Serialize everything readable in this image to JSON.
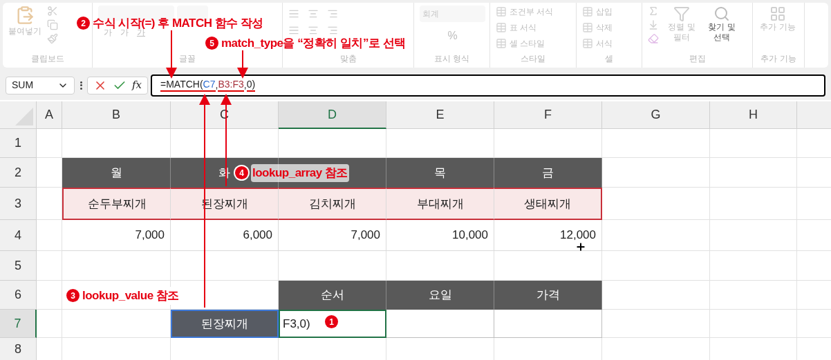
{
  "ribbon": {
    "groups": [
      {
        "kind": "clipboard",
        "label": "클립보드",
        "buttons": [
          {
            "label": "붙여넣기",
            "disabled": true
          }
        ]
      },
      {
        "kind": "font",
        "label": "글꼴",
        "buttons": [
          {
            "label": "가",
            "disabled": true
          },
          {
            "label": "가",
            "disabled": true
          },
          {
            "label": "가",
            "disabled": true
          }
        ]
      },
      {
        "kind": "alignment",
        "label": "맞춤"
      },
      {
        "kind": "number",
        "label": "표시 형식",
        "field": "회계",
        "buttons": [
          {
            "label": "%",
            "disabled": true
          }
        ]
      },
      {
        "kind": "styles",
        "label": "스타일",
        "buttons": [
          {
            "label": "조건부 서식",
            "disabled": true
          },
          {
            "label": "표 서식",
            "disabled": true
          },
          {
            "label": "셀 스타일",
            "disabled": true
          }
        ]
      },
      {
        "kind": "cells",
        "label": "셀",
        "buttons": [
          {
            "label": "삽입",
            "disabled": true
          },
          {
            "label": "삭제",
            "disabled": true
          },
          {
            "label": "서식",
            "disabled": true
          }
        ]
      },
      {
        "kind": "editing",
        "label": "편집",
        "buttons": [
          {
            "label": "정렬 및 필터",
            "disabled": true
          },
          {
            "label": "찾기 및 선택",
            "disabled": false
          }
        ]
      },
      {
        "kind": "addins",
        "label": "추가 기능",
        "buttons": [
          {
            "label": "추가 기능",
            "disabled": true
          }
        ]
      }
    ]
  },
  "name_box": {
    "value": "SUM"
  },
  "formula_bar": {
    "function_label": "fx",
    "tokens": [
      {
        "text": "=MATCH(",
        "underlined": true
      },
      {
        "text": "C7",
        "color": "#2f6fd0",
        "underlined": true
      },
      {
        "text": ",",
        "underlined": false
      },
      {
        "text": "B3:F3",
        "color": "#a8323c",
        "underlined": true
      },
      {
        "text": ",",
        "underlined": false
      },
      {
        "text": "0)",
        "underlined": true
      }
    ]
  },
  "sheet": {
    "columns": [
      {
        "label": "A",
        "selected": false
      },
      {
        "label": "B",
        "selected": false
      },
      {
        "label": "C",
        "selected": false
      },
      {
        "label": "D",
        "selected": true
      },
      {
        "label": "E",
        "selected": false
      },
      {
        "label": "F",
        "selected": false
      },
      {
        "label": "G",
        "selected": false
      },
      {
        "label": "H",
        "selected": false
      }
    ],
    "rows": [
      {
        "label": "1",
        "selected": false,
        "cells": [
          null,
          null,
          null,
          null,
          null,
          null,
          null,
          null
        ]
      },
      {
        "label": "2",
        "selected": false,
        "cells": [
          null,
          {
            "kind": "header",
            "text": "월"
          },
          {
            "kind": "header",
            "text": "화"
          },
          {
            "kind": "header"
          },
          {
            "kind": "header",
            "text": "목"
          },
          {
            "kind": "header",
            "text": "금"
          },
          null,
          null
        ]
      },
      {
        "label": "3",
        "selected": false,
        "cells": [
          null,
          {
            "kind": "range",
            "text": "순두부찌개"
          },
          {
            "kind": "range",
            "text": "된장찌개"
          },
          {
            "kind": "range",
            "text": "김치찌개"
          },
          {
            "kind": "range",
            "text": "부대찌개"
          },
          {
            "kind": "range",
            "text": "생태찌개"
          },
          null,
          null
        ]
      },
      {
        "label": "4",
        "selected": false,
        "cells": [
          null,
          {
            "kind": "number",
            "text": "7,000"
          },
          {
            "kind": "number",
            "text": "6,000"
          },
          {
            "kind": "number",
            "text": "7,000"
          },
          {
            "kind": "number",
            "text": "10,000"
          },
          {
            "kind": "number",
            "text": "12,000"
          },
          null,
          null
        ]
      },
      {
        "label": "5",
        "selected": false,
        "cells": [
          null,
          null,
          null,
          null,
          null,
          null,
          null,
          null
        ]
      },
      {
        "label": "6",
        "selected": false,
        "cells": [
          null,
          null,
          null,
          {
            "kind": "header",
            "text": "순서"
          },
          {
            "kind": "header",
            "text": "요일"
          },
          {
            "kind": "header",
            "text": "가격"
          },
          null,
          null
        ]
      },
      {
        "label": "7",
        "selected": true,
        "cells": [
          null,
          null,
          {
            "kind": "reference",
            "text": "된장찌개"
          },
          {
            "kind": "active",
            "text": "F3,0)"
          },
          {
            "kind": "plain"
          },
          {
            "kind": "plain"
          },
          null,
          null
        ]
      },
      {
        "label": "8",
        "selected": false,
        "cells": [
          null,
          null,
          null,
          null,
          null,
          null,
          null,
          null
        ]
      }
    ]
  },
  "annotations": [
    {
      "number": "2",
      "text": "수식 시작(=) 후 MATCH 함수 작성"
    },
    {
      "number": "5",
      "text": "match_type을 “정확히 일치”로 선택"
    },
    {
      "number": "4",
      "text": "lookup_array 참조"
    },
    {
      "number": "3",
      "text": "lookup_value 참조"
    },
    {
      "number": "1"
    }
  ]
}
